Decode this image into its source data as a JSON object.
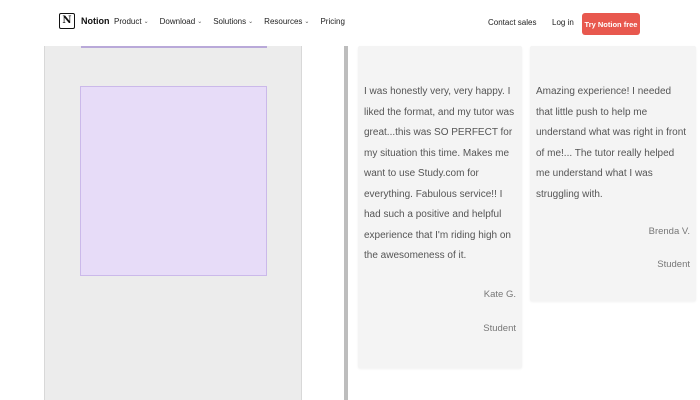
{
  "nav": {
    "brand": "Notion",
    "brand_mark": "N",
    "menu": [
      {
        "label": "Product",
        "dropdown": true
      },
      {
        "label": "Download",
        "dropdown": true
      },
      {
        "label": "Solutions",
        "dropdown": true
      },
      {
        "label": "Resources",
        "dropdown": true
      },
      {
        "label": "Pricing",
        "dropdown": false
      }
    ],
    "contact_sales": "Contact sales",
    "login": "Log in",
    "cta": "Try Notion free",
    "cta_color": "#e8584e"
  },
  "left_panel": {
    "highlight_color": "#e7dcf8",
    "lines": [
      "",
      "",
      "",
      ""
    ],
    "below_text": "",
    "below_link": ""
  },
  "testimonials": [
    {
      "quote": "I was honestly very, very happy. I liked the format, and my tutor was great...this was SO PERFECT for my situation this time. Makes me want to use Study.com for everything. Fabulous service!! I had such a positive and helpful experience that I'm riding high on the awesomeness of it.",
      "author": "Kate G.",
      "role": "Student"
    },
    {
      "quote": "Amazing experience! I needed that little push to help me understand what was right in front of me!... The tutor really helped me understand what I was struggling with.",
      "author": "Brenda V.",
      "role": "Student"
    }
  ]
}
